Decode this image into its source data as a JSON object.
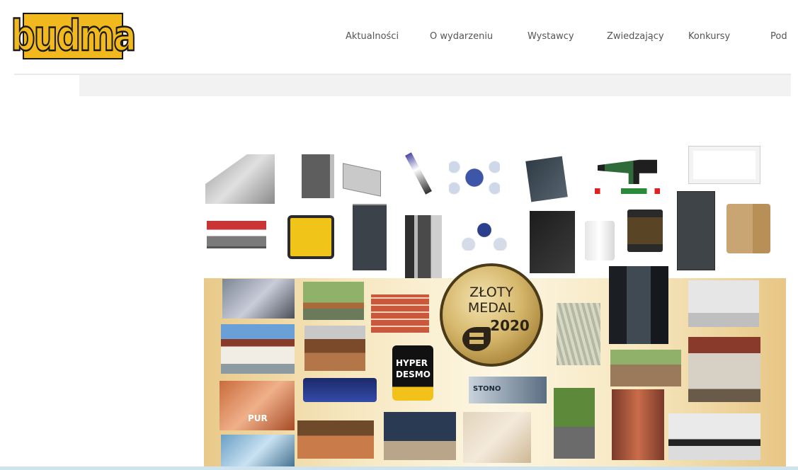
{
  "logo": {
    "text": "budma"
  },
  "nav": {
    "items": [
      {
        "label": "Aktualności"
      },
      {
        "label": "O wydarzeniu"
      },
      {
        "label": "Wystawcy"
      },
      {
        "label": "Zwiedzający"
      },
      {
        "label": "Konkursy"
      },
      {
        "label": "Pod"
      }
    ]
  },
  "banner": {
    "medal": {
      "line1": "ZŁOTY",
      "line2": "MEDAL",
      "year": "2020"
    },
    "product_labels": {
      "hyper": "HYPER",
      "desmo": "DESMO",
      "stono": "STONO",
      "pur": "PUR"
    }
  },
  "colors": {
    "logo_yellow": "#f2b91f",
    "nav_text": "#555555",
    "gold": "#d6b86d",
    "banner_warm": "#f6e7bf"
  }
}
